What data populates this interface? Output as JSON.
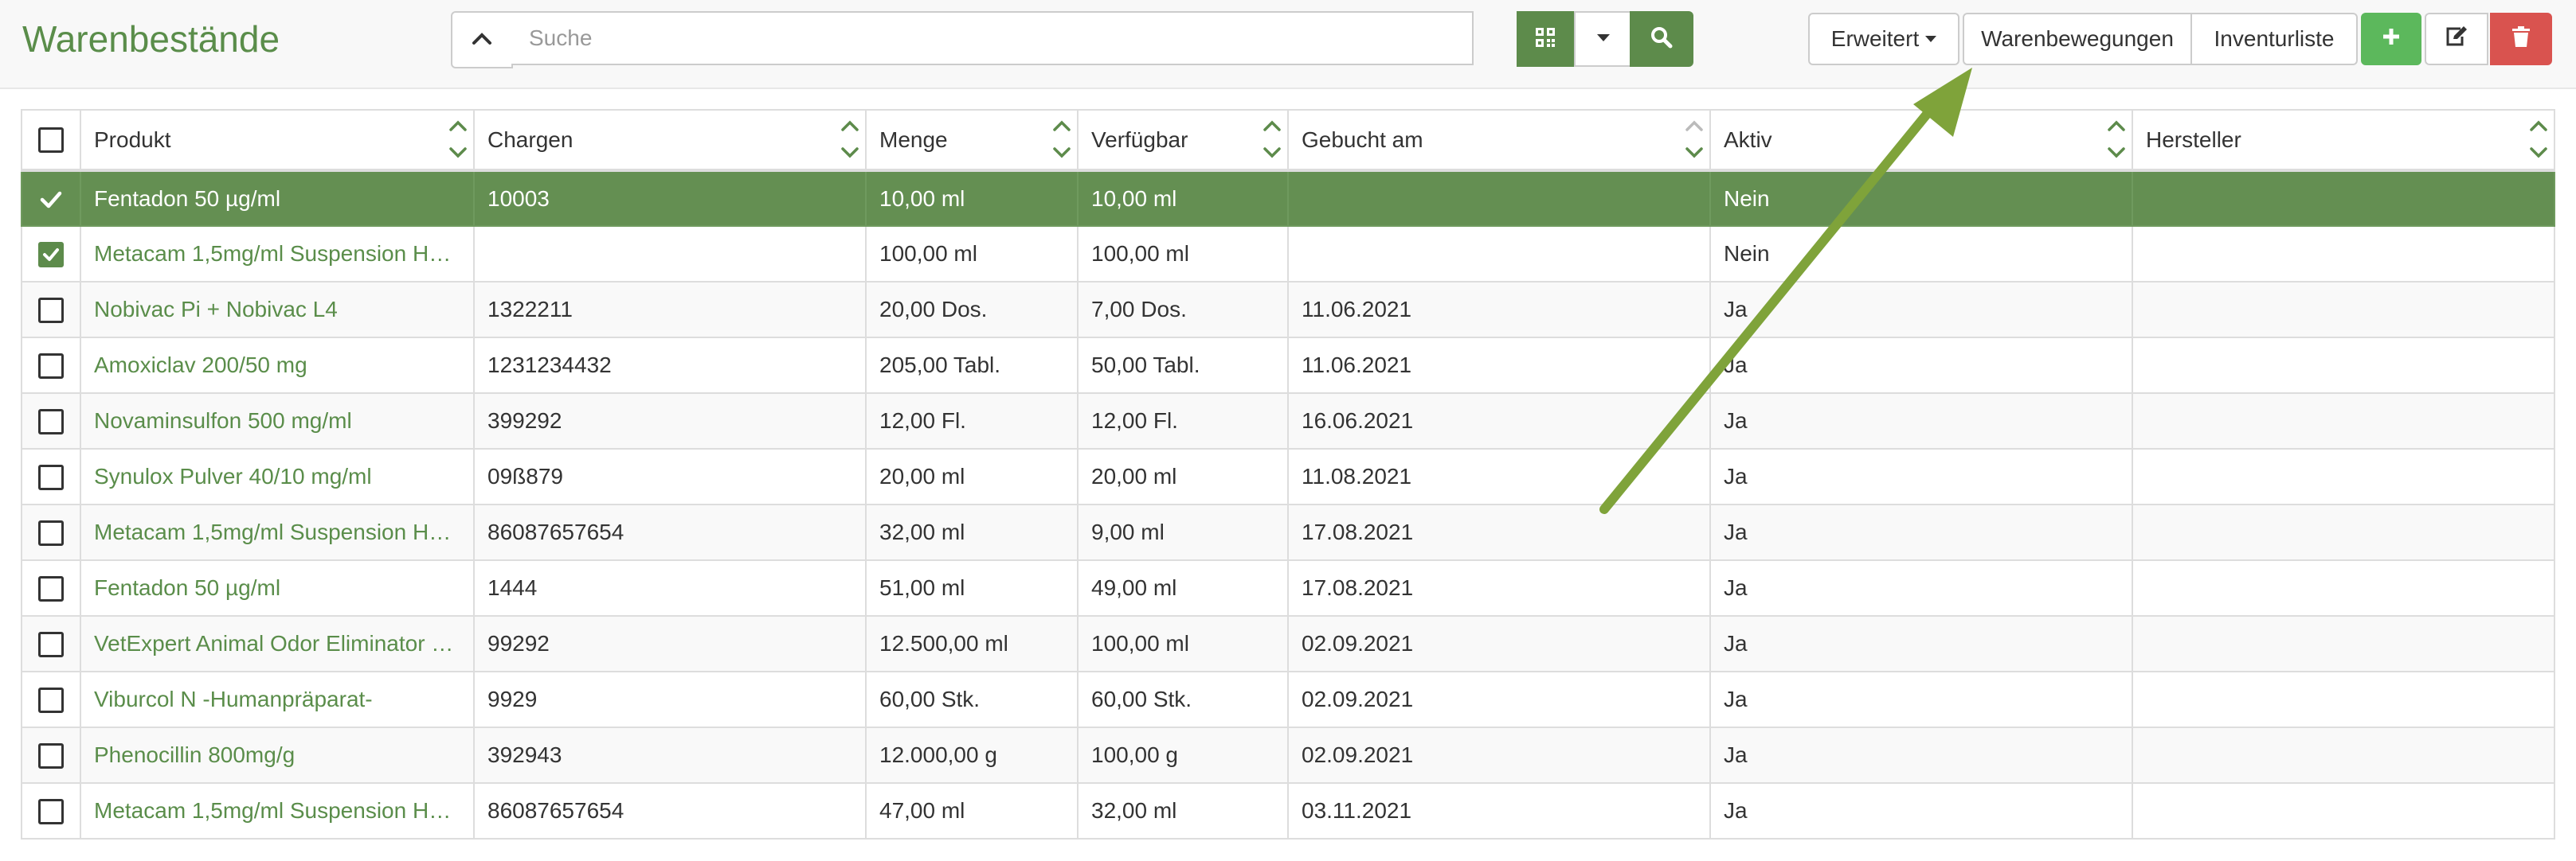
{
  "header": {
    "title": "Warenbestände",
    "search_placeholder": "Suche",
    "search_value": "",
    "erweitert_label": "Erweitert",
    "warenbewegungen_label": "Warenbewegungen",
    "inventurliste_label": "Inventurliste"
  },
  "colors": {
    "brand_green": "#5d8b4b",
    "selected_row": "#648f52",
    "delete_red": "#d9534f",
    "add_green": "#5cb85c",
    "arrow": "#7fa33a"
  },
  "icons": {
    "collapse": "chevron-up-icon",
    "qr": "qr-code-icon",
    "dropdown": "caret-down-icon",
    "search": "search-icon",
    "add": "plus-icon",
    "edit": "edit-icon",
    "delete": "trash-icon"
  },
  "table": {
    "columns": [
      "Produkt",
      "Chargen",
      "Menge",
      "Verfügbar",
      "Gebucht am",
      "Aktiv",
      "Hersteller"
    ],
    "rows": [
      {
        "selected": true,
        "checked": true,
        "produkt": "Fentadon 50 µg/ml",
        "chargen": "10003",
        "menge": "10,00 ml",
        "verfuegbar": "10,00 ml",
        "gebucht": "",
        "aktiv": "Nein",
        "hersteller": ""
      },
      {
        "selected": false,
        "checked": true,
        "produkt": "Metacam 1,5mg/ml Suspension Hu…",
        "chargen": "",
        "menge": "100,00 ml",
        "verfuegbar": "100,00 ml",
        "gebucht": "",
        "aktiv": "Nein",
        "hersteller": ""
      },
      {
        "selected": false,
        "checked": false,
        "produkt": "Nobivac Pi + Nobivac L4",
        "chargen": "1322211",
        "menge": "20,00 Dos.",
        "verfuegbar": "7,00 Dos.",
        "gebucht": "11.06.2021",
        "aktiv": "Ja",
        "hersteller": ""
      },
      {
        "selected": false,
        "checked": false,
        "produkt": "Amoxiclav 200/50 mg",
        "chargen": "1231234432",
        "menge": "205,00 Tabl.",
        "verfuegbar": "50,00 Tabl.",
        "gebucht": "11.06.2021",
        "aktiv": "Ja",
        "hersteller": ""
      },
      {
        "selected": false,
        "checked": false,
        "produkt": "Novaminsulfon 500 mg/ml",
        "chargen": "399292",
        "menge": "12,00 Fl.",
        "verfuegbar": "12,00 Fl.",
        "gebucht": "16.06.2021",
        "aktiv": "Ja",
        "hersteller": ""
      },
      {
        "selected": false,
        "checked": false,
        "produkt": "Synulox Pulver 40/10 mg/ml",
        "chargen": "09ß879",
        "menge": "20,00 ml",
        "verfuegbar": "20,00 ml",
        "gebucht": "11.08.2021",
        "aktiv": "Ja",
        "hersteller": ""
      },
      {
        "selected": false,
        "checked": false,
        "produkt": "Metacam 1,5mg/ml Suspension Hu…",
        "chargen": "86087657654",
        "menge": "32,00 ml",
        "verfuegbar": "9,00 ml",
        "gebucht": "17.08.2021",
        "aktiv": "Ja",
        "hersteller": ""
      },
      {
        "selected": false,
        "checked": false,
        "produkt": "Fentadon 50 µg/ml",
        "chargen": "1444",
        "menge": "51,00 ml",
        "verfuegbar": "49,00 ml",
        "gebucht": "17.08.2021",
        "aktiv": "Ja",
        "hersteller": ""
      },
      {
        "selected": false,
        "checked": false,
        "produkt": "VetExpert Animal Odor Eliminator S…",
        "chargen": "99292",
        "menge": "12.500,00 ml",
        "verfuegbar": "100,00 ml",
        "gebucht": "02.09.2021",
        "aktiv": "Ja",
        "hersteller": ""
      },
      {
        "selected": false,
        "checked": false,
        "produkt": "Viburcol N -Humanpräparat-",
        "chargen": "9929",
        "menge": "60,00 Stk.",
        "verfuegbar": "60,00 Stk.",
        "gebucht": "02.09.2021",
        "aktiv": "Ja",
        "hersteller": ""
      },
      {
        "selected": false,
        "checked": false,
        "produkt": "Phenocillin 800mg/g",
        "chargen": "392943",
        "menge": "12.000,00 g",
        "verfuegbar": "100,00 g",
        "gebucht": "02.09.2021",
        "aktiv": "Ja",
        "hersteller": ""
      },
      {
        "selected": false,
        "checked": false,
        "produkt": "Metacam 1,5mg/ml Suspension Hu…",
        "chargen": "86087657654",
        "menge": "47,00 ml",
        "verfuegbar": "32,00 ml",
        "gebucht": "03.11.2021",
        "aktiv": "Ja",
        "hersteller": ""
      }
    ]
  }
}
